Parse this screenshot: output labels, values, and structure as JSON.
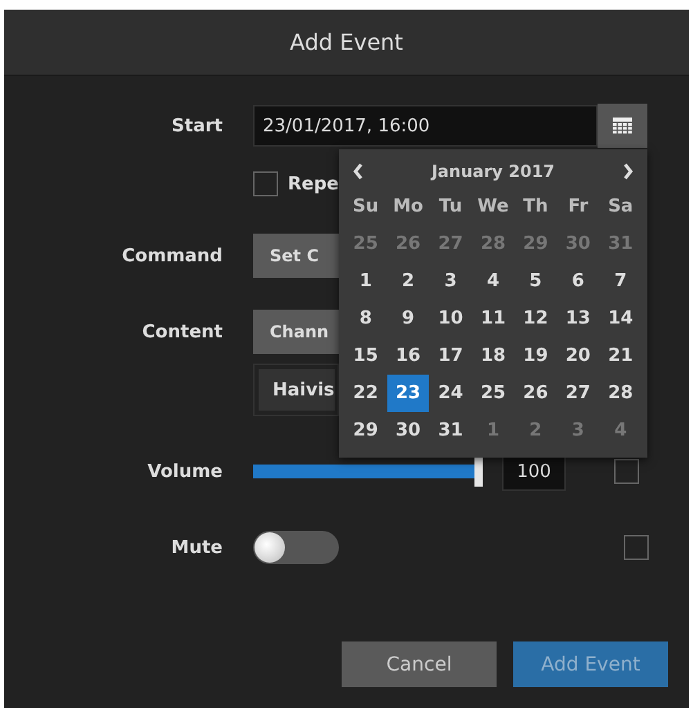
{
  "dialog": {
    "title": "Add Event"
  },
  "start": {
    "label": "Start",
    "value": "23/01/2017, 16:00"
  },
  "repeat": {
    "label": "Repe",
    "checked": false
  },
  "command": {
    "label": "Command",
    "value": "Set C"
  },
  "content": {
    "label": "Content",
    "value": "Chann",
    "source": "Haivis"
  },
  "volume": {
    "label": "Volume",
    "level": 1.0,
    "reading": "100",
    "override": false
  },
  "mute": {
    "label": "Mute",
    "on": false,
    "override": false
  },
  "calendar": {
    "month": "January 2017",
    "weekdays": [
      "Su",
      "Mo",
      "Tu",
      "We",
      "Th",
      "Fr",
      "Sa"
    ],
    "days": [
      {
        "label": "25",
        "other_month": true,
        "selected": false
      },
      {
        "label": "26",
        "other_month": true,
        "selected": false
      },
      {
        "label": "27",
        "other_month": true,
        "selected": false
      },
      {
        "label": "28",
        "other_month": true,
        "selected": false
      },
      {
        "label": "29",
        "other_month": true,
        "selected": false
      },
      {
        "label": "30",
        "other_month": true,
        "selected": false
      },
      {
        "label": "31",
        "other_month": true,
        "selected": false
      },
      {
        "label": "1",
        "other_month": false,
        "selected": false
      },
      {
        "label": "2",
        "other_month": false,
        "selected": false
      },
      {
        "label": "3",
        "other_month": false,
        "selected": false
      },
      {
        "label": "4",
        "other_month": false,
        "selected": false
      },
      {
        "label": "5",
        "other_month": false,
        "selected": false
      },
      {
        "label": "6",
        "other_month": false,
        "selected": false
      },
      {
        "label": "7",
        "other_month": false,
        "selected": false
      },
      {
        "label": "8",
        "other_month": false,
        "selected": false
      },
      {
        "label": "9",
        "other_month": false,
        "selected": false
      },
      {
        "label": "10",
        "other_month": false,
        "selected": false
      },
      {
        "label": "11",
        "other_month": false,
        "selected": false
      },
      {
        "label": "12",
        "other_month": false,
        "selected": false
      },
      {
        "label": "13",
        "other_month": false,
        "selected": false
      },
      {
        "label": "14",
        "other_month": false,
        "selected": false
      },
      {
        "label": "15",
        "other_month": false,
        "selected": false
      },
      {
        "label": "16",
        "other_month": false,
        "selected": false
      },
      {
        "label": "17",
        "other_month": false,
        "selected": false
      },
      {
        "label": "18",
        "other_month": false,
        "selected": false
      },
      {
        "label": "19",
        "other_month": false,
        "selected": false
      },
      {
        "label": "20",
        "other_month": false,
        "selected": false
      },
      {
        "label": "21",
        "other_month": false,
        "selected": false
      },
      {
        "label": "22",
        "other_month": false,
        "selected": false
      },
      {
        "label": "23",
        "other_month": false,
        "selected": true
      },
      {
        "label": "24",
        "other_month": false,
        "selected": false
      },
      {
        "label": "25",
        "other_month": false,
        "selected": false
      },
      {
        "label": "26",
        "other_month": false,
        "selected": false
      },
      {
        "label": "27",
        "other_month": false,
        "selected": false
      },
      {
        "label": "28",
        "other_month": false,
        "selected": false
      },
      {
        "label": "29",
        "other_month": false,
        "selected": false
      },
      {
        "label": "30",
        "other_month": false,
        "selected": false
      },
      {
        "label": "31",
        "other_month": false,
        "selected": false
      },
      {
        "label": "1",
        "other_month": true,
        "selected": false
      },
      {
        "label": "2",
        "other_month": true,
        "selected": false
      },
      {
        "label": "3",
        "other_month": true,
        "selected": false
      },
      {
        "label": "4",
        "other_month": true,
        "selected": false
      }
    ]
  },
  "buttons": [
    {
      "label": "Cancel",
      "kind": "secondary",
      "disabled": false
    },
    {
      "label": "Add Event",
      "kind": "primary",
      "disabled": true
    }
  ]
}
